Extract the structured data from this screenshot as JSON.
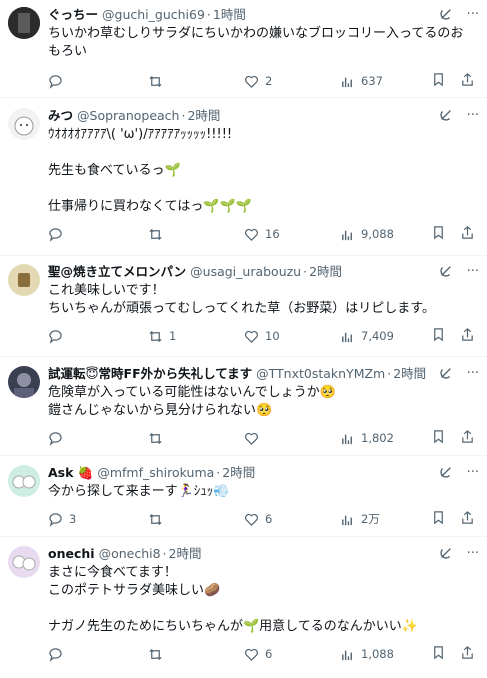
{
  "tweets": [
    {
      "name": "ぐっちー",
      "handle": "@guchi_guchi69",
      "time": "1時間",
      "text": "ちいかわ草むしりサラダにちいかわの嫌いなブロッコリー入ってるのおもろい",
      "replies": "",
      "retweets": "",
      "likes": "2",
      "views": "637",
      "avatar_color": "#2b2b2b"
    },
    {
      "name": "みつ",
      "handle": "@Sopranopeach",
      "time": "2時間",
      "text": "ｳｵｵｵｵｱｱｱｱ\\( 'ω')/ｱｱｱｱｱｯｯｯｯ!!!!!\n\n先生も食べているっ🌱\n\n仕事帰りに買わなくてはっ🌱🌱🌱",
      "replies": "",
      "retweets": "",
      "likes": "16",
      "views": "9,088",
      "avatar_color": "#f0f0f0"
    },
    {
      "name": "聖@焼き立てメロンパン",
      "handle": "@usagi_urabouzu",
      "time": "2時間",
      "text": "これ美味しいです！\nちいちゃんが頑張ってむしってくれた草（お野菜）はリピします。",
      "replies": "",
      "retweets": "1",
      "likes": "10",
      "views": "7,409",
      "avatar_color": "#c9b88a"
    },
    {
      "name": "試運転😇常時FF外から失礼してます",
      "handle": "@TTnxt0staknYMZm",
      "time": "2時間",
      "text": "危険草が入っている可能性はないんでしょうか🥺\n鎧さんじゃないから見分けられない🥺",
      "replies": "",
      "retweets": "",
      "likes": "",
      "views": "1,802",
      "avatar_color": "#3a3f52"
    },
    {
      "name": "Ask 🍓",
      "handle": "@mfmf_shirokuma",
      "time": "2時間",
      "text": "今から探して来まーす🏃‍♀️ｼｭｯ💨",
      "replies": "3",
      "retweets": "",
      "likes": "6",
      "views": "2万",
      "avatar_color": "#b9e6d8"
    },
    {
      "name": "onechi",
      "handle": "@onechi8",
      "time": "2時間",
      "text": "まさに今食べてます！\nこのポテトサラダ美味しい🥔\n\nナガノ先生のためにちいちゃんが🌱用意してるのなんかいい✨",
      "replies": "",
      "retweets": "",
      "likes": "6",
      "views": "1,088",
      "avatar_color": "#d9c6e8"
    }
  ]
}
